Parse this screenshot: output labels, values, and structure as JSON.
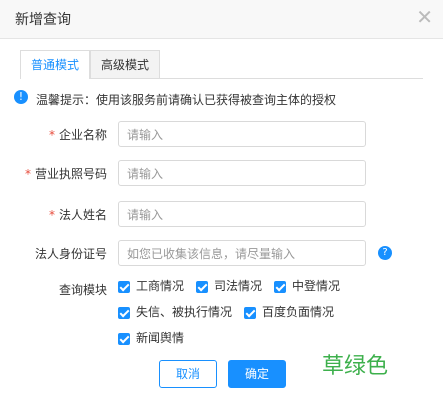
{
  "dialog": {
    "title": "新增查询"
  },
  "tabs": [
    {
      "label": "普通模式",
      "active": true
    },
    {
      "label": "高级模式",
      "active": false
    }
  ],
  "tip": {
    "text": "温馨提示：使用该服务前请确认已获得被查询主体的授权"
  },
  "form": {
    "company_name": {
      "label": "企业名称",
      "placeholder": "请输入",
      "required": true
    },
    "license_no": {
      "label": "营业执照号码",
      "placeholder": "请输入",
      "required": true
    },
    "legal_name": {
      "label": "法人姓名",
      "placeholder": "请输入",
      "required": true
    },
    "legal_id": {
      "label": "法人身份证号",
      "placeholder": "如您已收集该信息，请尽量输入",
      "required": false
    },
    "modules": {
      "label": "查询模块",
      "items": [
        "工商情况",
        "司法情况",
        "中登情况",
        "失信、被执行情况",
        "百度负面情况",
        "新闻舆情"
      ]
    }
  },
  "buttons": {
    "cancel": "取消",
    "ok": "确定"
  },
  "watermark": "草绿色",
  "colors": {
    "accent": "#1890ff",
    "required": "#e74c3c",
    "watermark": "#3db04c"
  }
}
